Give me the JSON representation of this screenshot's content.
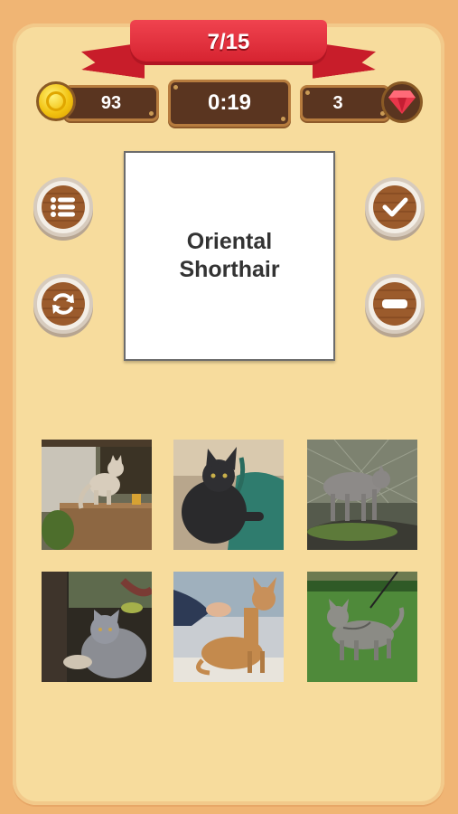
{
  "header": {
    "progress": "7/15"
  },
  "stats": {
    "coins": "93",
    "timer": "0:19",
    "gems": "3"
  },
  "icons": {
    "coin": "coin-icon",
    "gem": "gem-icon",
    "list": "list-icon",
    "refresh": "refresh-icon",
    "check": "check-icon",
    "minus": "minus-icon"
  },
  "colors": {
    "ribbon": "#d4212e",
    "panel": "#f7dc9d",
    "background": "#f0b574",
    "wood": "#5a3520"
  },
  "word_card": {
    "text": "Oriental\nShorthair"
  },
  "photos": [
    {
      "subject": "cream cat on wooden fence"
    },
    {
      "subject": "black cat on green bench"
    },
    {
      "subject": "gray cat near wire fence"
    },
    {
      "subject": "gray cat in garden"
    },
    {
      "subject": "ginger oriental cat being groomed"
    },
    {
      "subject": "gray tabby cat on leash on grass"
    }
  ]
}
